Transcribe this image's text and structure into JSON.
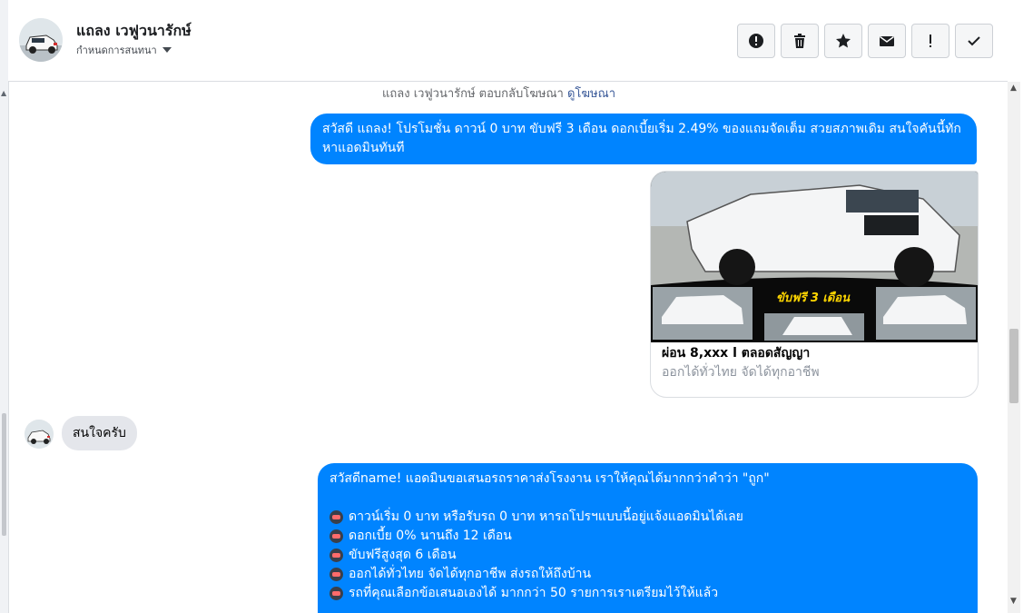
{
  "header": {
    "name": "แถลง เวฟูวนารักษ์",
    "assign_label": "กำหนดการสนทนา",
    "tools": [
      {
        "name": "mark-spam-button",
        "icon": "alert-circle-icon"
      },
      {
        "name": "delete-button",
        "icon": "trash-icon"
      },
      {
        "name": "star-button",
        "icon": "star-icon"
      },
      {
        "name": "mark-unread-button",
        "icon": "envelope-icon"
      },
      {
        "name": "follow-up-button",
        "icon": "exclamation-icon"
      },
      {
        "name": "done-button",
        "icon": "check-icon"
      }
    ]
  },
  "chat": {
    "notice_prefix": "แถลง เวฟูวนารักษ์ ตอบกลับโฆษณา",
    "notice_link": "ดูโฆษณา",
    "msg1": "สวัสดี แถลง! โปรโมชั่น ดาวน์ 0 บาท ขับฟรี 3 เดือน ดอกเบี้ยเริ่ม 2.49% ของแถมจัดเต็ม สวยสภาพเดิม สนใจคันนี้ทักหาแอดมินทันที",
    "card": {
      "banner_text": "ขับฟรี 3 เดือน",
      "title": "ผ่อน 8,xxx l ตลอดสัญญา",
      "subtitle": "ออกได้ทั่วไทย จัดได้ทุกอาชีพ"
    },
    "reply": "สนใจครับ",
    "msg3": {
      "intro": "สวัสดีname! แอดมินขอเสนอรถราคาส่งโรงงาน เราให้คุณได้มากกว่าคำว่า \"ถูก\"",
      "lines": [
        "ดาวน์เริ่ม 0 บาท หรือรับรถ 0 บาท หารถโปรฯแบบนี้อยู่แจ้งแอดมินได้เลย",
        "ดอกเบี้ย 0% นานถึง 12 เดือน",
        "ขับฟรีสูงสุด 6 เดือน",
        "ออกได้ทั่วไทย จัดได้ทุกอาชีพ ส่งรถให้ถึงบ้าน",
        "รถที่คุณเลือกข้อเสนอเองได้ มากกว่า 50 รายการเราเตรียมไว้ให้แล้ว"
      ]
    }
  },
  "colors": {
    "outgoing_bubble": "#0084ff",
    "incoming_bubble": "#e4e6eb",
    "link": "#385898"
  }
}
